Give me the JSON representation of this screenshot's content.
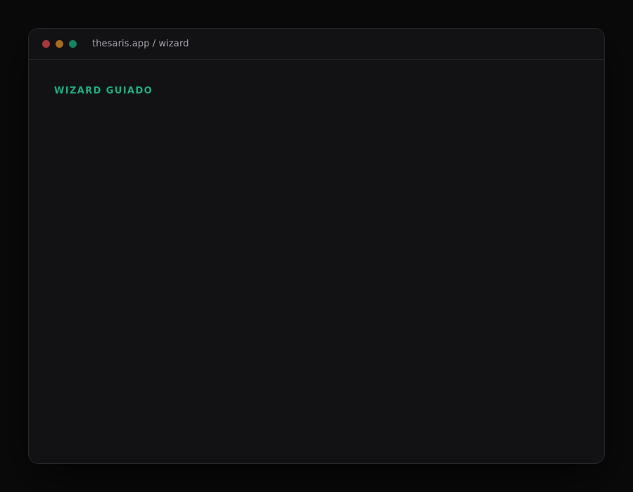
{
  "window": {
    "title": "thesaris.app / wizard",
    "controls": {
      "close_color": "#a8393a",
      "minimize_color": "#a86a1f",
      "maximize_color": "#16835f"
    }
  },
  "main": {
    "heading": "WIZARD GUIADO",
    "heading_color": "#1fb07e"
  }
}
